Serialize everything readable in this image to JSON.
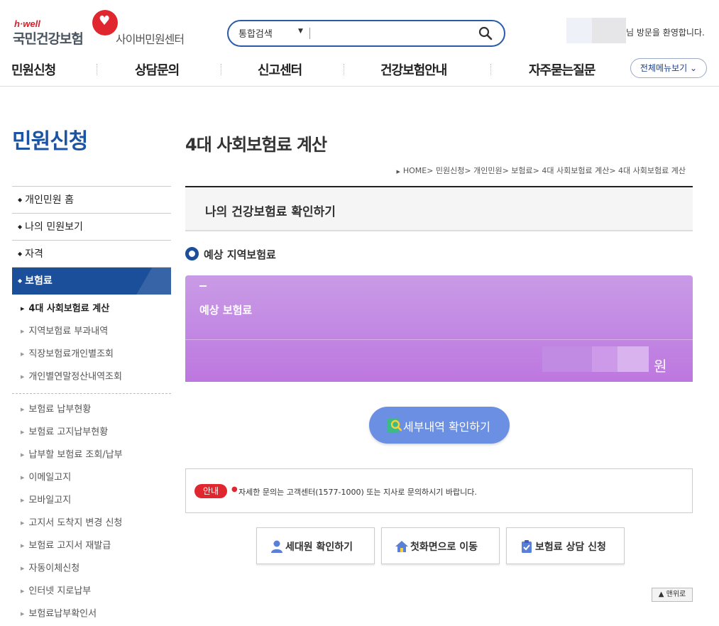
{
  "header": {
    "logo": {
      "tagline": "h·well",
      "org_name": "국민건강보험",
      "center_name": "사이버민원센터"
    },
    "search": {
      "scope": "통합검색",
      "query": "",
      "placeholder": ""
    },
    "welcome": "님 방문을 환영합니다.",
    "gnb": [
      "민원신청",
      "상담문의",
      "신고센터",
      "건강보험안내",
      "자주묻는질문"
    ],
    "all_menu": "전체메뉴보기"
  },
  "sidebar": {
    "title": "민원신청",
    "top_items": [
      "개인민원 홈",
      "나의 민원보기",
      "자격"
    ],
    "active_item": "보험료",
    "sub_group1": [
      "4대 사회보험료 계산",
      "지역보험료 부과내역",
      "직장보험료개인별조회",
      "개인별연말정산내역조회"
    ],
    "sub_group2": [
      "보험료 납부현황",
      "보험료 고지납부현황",
      "납부할 보험료 조회/납부",
      "이메일고지",
      "모바일고지",
      "고지서 도착지 변경 신청",
      "보험료 고지서 재발급",
      "자동이체신청",
      "인터넷 지로납부",
      "보험료납부확인서"
    ]
  },
  "main": {
    "page_title": "4대 사회보험료 계산",
    "breadcrumb": "HOME> 민원신청> 개인민원> 보험료> 4대 사회보험료 계산> 4대 사회보험료 계산",
    "section_title": "나의 건강보험료 확인하기",
    "radio_label": "예상 지역보험료",
    "premium_label": "예상 보험료",
    "premium_value": "",
    "premium_unit": "원",
    "detail_button": "세부내역 확인하기",
    "notice_badge": "안내",
    "notice_text": "자세한 문의는 고객센터(1577-1000) 또는 지사로 문의하시기 바랍니다.",
    "buttons": [
      "세대원 확인하기",
      "첫화면으로 이동",
      "보험료 상담 신청"
    ],
    "top_button": "맨위로"
  }
}
